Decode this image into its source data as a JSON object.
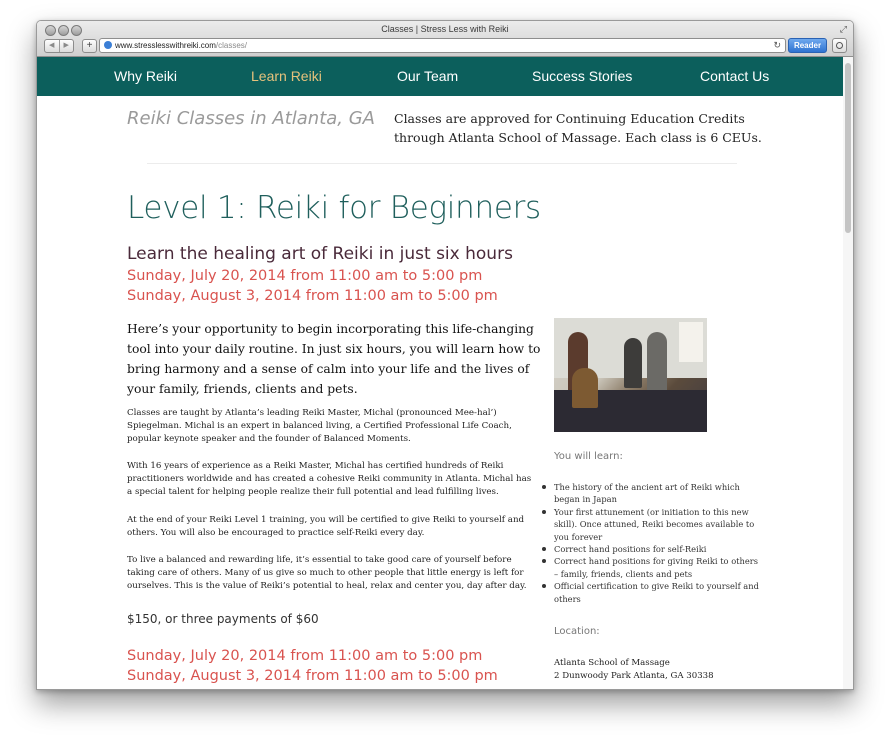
{
  "browser": {
    "window_title": "Classes | Stress Less with Reiki",
    "url_domain": "www.stresslesswithreiki.com",
    "url_path": "/classes/",
    "reader_label": "Reader",
    "plus_label": "+",
    "back_glyph": "◀",
    "forward_glyph": "▶",
    "reload_glyph": "↻",
    "resize_glyph": "⤢"
  },
  "nav": {
    "items": [
      "Why Reiki",
      "Learn Reiki",
      "Our Team",
      "Success Stories",
      "Contact Us"
    ],
    "active_color": "#e6c27c",
    "bar_color": "#0c5f5c"
  },
  "header": {
    "page_heading": "Reiki Classes in Atlanta, GA",
    "ceu_note": "Classes are approved for Continuing Education Credits through Atlanta School of Massage. Each class is 6 CEUs."
  },
  "main": {
    "title": "Level 1: Reiki for Beginners",
    "subtitle": "Learn the healing art of Reiki in just six hours",
    "dates": [
      "Sunday, July 20, 2014 from 11:00 am to 5:00 pm",
      "Sunday, August 3, 2014 from 11:00 am to 5:00 pm"
    ],
    "lead": "Here’s your opportunity to begin incorporating this life-changing tool into your daily routine. In just six hours, you will learn how to bring harmony and a sense of calm into your life and the lives of your family, friends, clients and pets.",
    "paragraphs": [
      "Classes are taught by Atlanta’s leading Reiki Master, Michal (pronounced Mee-hal’) Spiegelman. Michal is an expert in balanced living, a Certified Professional Life Coach, popular keynote speaker and the founder of Balanced Moments.",
      "With 16 years of experience as a Reiki Master, Michal has certified hundreds of Reiki practitioners worldwide and has created a cohesive Reiki community in Atlanta. Michal has a special talent for helping people realize their full potential and lead fulfilling lives.",
      "At the end of your Reiki Level 1 training, you will be certified to give Reiki to yourself and others. You will also be encouraged to practice self-Reiki every day.",
      "To live a balanced and rewarding life, it’s essential to take good care of yourself before taking care of others. Many of us give so much to other people that little energy is left for ourselves. This is the value of Reiki’s potential to heal, relax and center you, day after day."
    ],
    "price": "$150, or three payments of $60",
    "bottom_dates": [
      "Sunday, July 20, 2014 from 11:00 am to 5:00 pm",
      "Sunday, August 3, 2014 from 11:00 am to 5:00 pm"
    ]
  },
  "sidebar": {
    "learn_label": "You will learn:",
    "learn_items": [
      "The history of the ancient art of Reiki which began in Japan",
      "Your first attunement (or initiation to this new skill). Once attuned, Reiki becomes available to you forever",
      "Correct hand positions for self-Reiki",
      "Correct hand positions for giving Reiki to others – family, friends, clients and pets",
      "Official certification to give Reiki to yourself and others"
    ],
    "location_label": "Location:",
    "location_name": "Atlanta School of Massage",
    "location_address": "2 Dunwoody Park Atlanta, GA 30338"
  }
}
